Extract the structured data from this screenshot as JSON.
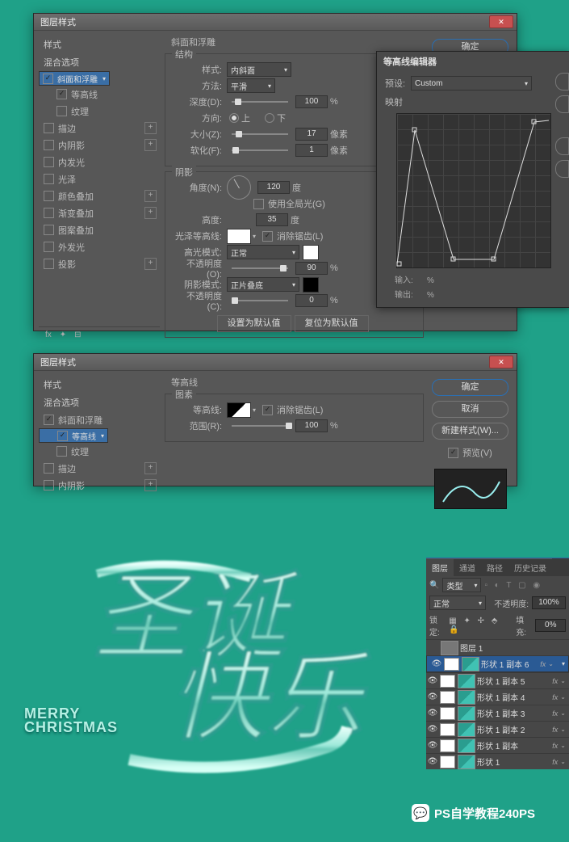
{
  "dialog1": {
    "title": "图层样式",
    "ok": "确定",
    "sidebar": {
      "style": "样式",
      "blend": "混合选项",
      "items": [
        {
          "label": "斜面和浮雕",
          "checked": true,
          "sel": true
        },
        {
          "label": "等高线",
          "checked": true,
          "indent": true
        },
        {
          "label": "纹理",
          "checked": false,
          "indent": true
        },
        {
          "label": "描边",
          "checked": false,
          "plus": true
        },
        {
          "label": "内阴影",
          "checked": false,
          "plus": true
        },
        {
          "label": "内发光",
          "checked": false
        },
        {
          "label": "光泽",
          "checked": false
        },
        {
          "label": "颜色叠加",
          "checked": false,
          "plus": true
        },
        {
          "label": "渐变叠加",
          "checked": false,
          "plus": true
        },
        {
          "label": "图案叠加",
          "checked": false
        },
        {
          "label": "外发光",
          "checked": false
        },
        {
          "label": "投影",
          "checked": false,
          "plus": true
        }
      ]
    },
    "bevel": {
      "title": "斜面和浮雕",
      "struct": "结构",
      "style_l": "样式:",
      "style_v": "内斜面",
      "tech_l": "方法:",
      "tech_v": "平滑",
      "depth_l": "深度(D):",
      "depth_v": "100",
      "pct": "%",
      "dir_l": "方向:",
      "up": "上",
      "down": "下",
      "size_l": "大小(Z):",
      "size_v": "17",
      "px": "像素",
      "soft_l": "软化(F):",
      "soft_v": "1",
      "shade": "阴影",
      "ang_l": "角度(N):",
      "ang_v": "120",
      "deg": "度",
      "glob": "使用全局光(G)",
      "alt_l": "高度:",
      "alt_v": "35",
      "gloss_l": "光泽等高线:",
      "aa": "消除锯齿(L)",
      "hm_l": "高光模式:",
      "hm_v": "正常",
      "ho_l": "不透明度(O):",
      "ho_v": "90",
      "sm_l": "阴影模式:",
      "sm_v": "正片叠底",
      "so_l": "不透明度(C):",
      "so_v": "0",
      "def": "设置为默认值",
      "rst": "复位为默认值"
    },
    "fx": {
      "a": "fx",
      "b": "✦",
      "c": "⊟"
    }
  },
  "curve": {
    "title": "等高线编辑器",
    "preset_l": "预设:",
    "preset_v": "Custom",
    "map": "映射",
    "in_l": "输入:",
    "out_l": "输出:",
    "pct": "%"
  },
  "dialog2": {
    "title": "图层样式",
    "ok": "确定",
    "cancel": "取消",
    "new": "新建样式(W)...",
    "prev": "预览(V)",
    "sidebar": {
      "style": "样式",
      "blend": "混合选项",
      "items": [
        {
          "label": "斜面和浮雕",
          "checked": true
        },
        {
          "label": "等高线",
          "checked": true,
          "indent": true,
          "sel": true
        },
        {
          "label": "纹理",
          "checked": false,
          "indent": true
        },
        {
          "label": "描边",
          "checked": false,
          "plus": true
        },
        {
          "label": "内阴影",
          "checked": false,
          "plus": true
        }
      ]
    },
    "contour": {
      "title": "等高线",
      "img": "图素",
      "cl": "等高线:",
      "aa": "消除锯齿(L)",
      "range_l": "范围(R):",
      "range_v": "100",
      "pct": "%"
    }
  },
  "layers": {
    "tabs": [
      "图层",
      "通道",
      "路径",
      "历史记录"
    ],
    "kind": "类型",
    "mode": "正常",
    "opac_l": "不透明度:",
    "opac_v": "100%",
    "lock": "锁定:",
    "fill_l": "填充:",
    "fill_v": "0%",
    "items": [
      {
        "name": "图层 1",
        "vis": false,
        "plain": true
      },
      {
        "name": "形状 1 副本 6",
        "vis": true,
        "fx": true,
        "sel": true
      },
      {
        "name": "形状 1 副本 5",
        "vis": true,
        "fx": true
      },
      {
        "name": "形状 1 副本 4",
        "vis": true,
        "fx": true
      },
      {
        "name": "形状 1 副本 3",
        "vis": true,
        "fx": true
      },
      {
        "name": "形状 1 副本 2",
        "vis": true,
        "fx": true
      },
      {
        "name": "形状 1 副本",
        "vis": true,
        "fx": true
      },
      {
        "name": "形状 1",
        "vis": true,
        "fx": true
      }
    ]
  },
  "art": {
    "en1": "MERRY",
    "en2": "CHRISTMAS"
  },
  "watermark": "PS自学教程240PS"
}
